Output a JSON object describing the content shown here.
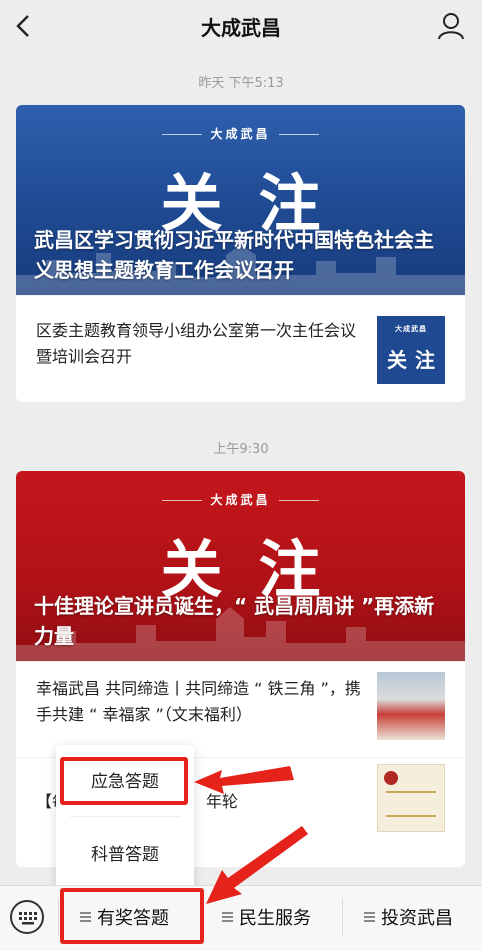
{
  "header": {
    "back_icon": "chevron-left-icon",
    "title": "大成武昌",
    "profile_icon": "person-icon"
  },
  "feed": [
    {
      "time": "昨天 下午5:13",
      "cover": {
        "brand": "大成武昌",
        "big_text": "关注",
        "headline": "武昌区学习贯彻习近平新时代中国特色社会主义思想主题教育工作会议召开",
        "color": "#1f4a92"
      },
      "items": [
        {
          "text": "区委主题教育领导小组办公室第一次主任会议暨培训会召开",
          "thumb_brand": "大成武昌",
          "thumb_text": "关注"
        }
      ]
    },
    {
      "time": "上午9:30",
      "cover": {
        "brand": "大成武昌",
        "big_text": "关注",
        "headline": "十佳理论宣讲员诞生，“ 武昌周周讲 ”再添新力量",
        "color": "#b01217"
      },
      "items": [
        {
          "text": "幸福武昌 共同缔造丨共同缔造 “ 铁三角 ”，携手共建 “ 幸福家 ”（文末福利）"
        },
        {
          "text_left": "【每",
          "text_right": "年轮"
        }
      ]
    }
  ],
  "popup_menu": {
    "items": [
      "应急答题",
      "科普答题"
    ]
  },
  "bottom_menu": {
    "keyboard_icon": "keyboard-icon",
    "items": [
      "有奖答题",
      "民生服务",
      "投资武昌"
    ]
  },
  "annotation": {
    "highlight_color": "#e6231b"
  }
}
